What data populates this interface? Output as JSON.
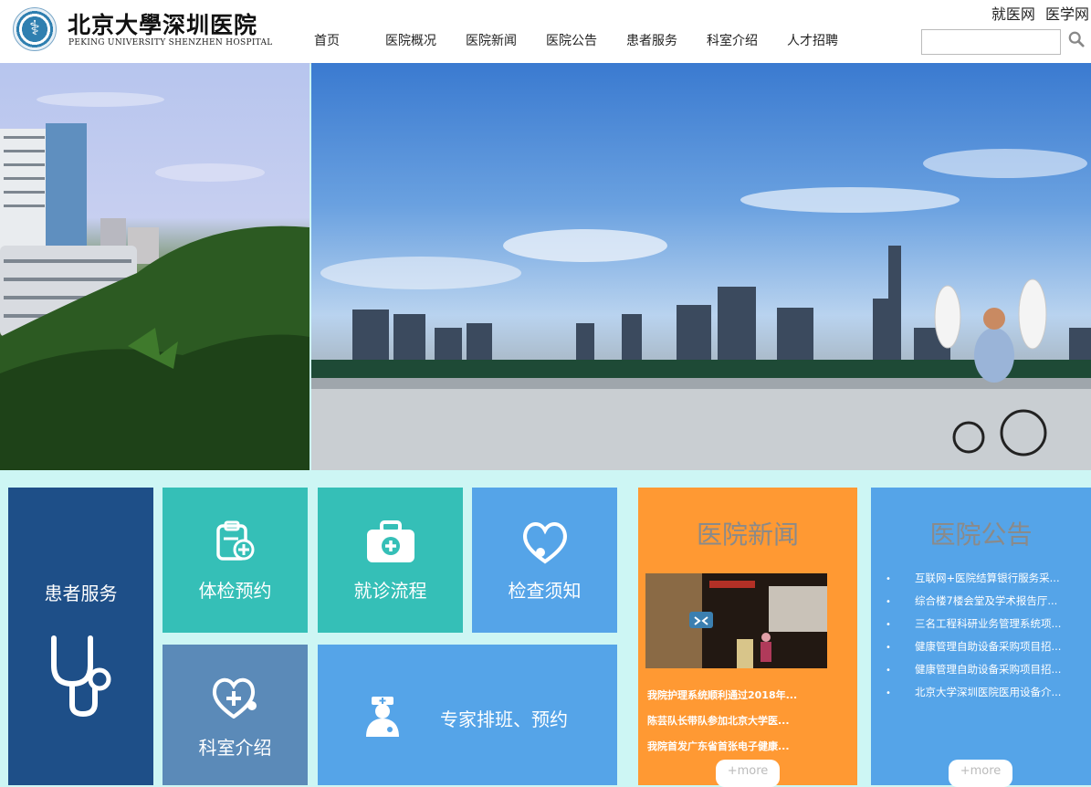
{
  "header": {
    "logo_cn": "北京大學深圳医院",
    "logo_en": "PEKING UNIVERSITY SHENZHEN HOSPITAL",
    "top_links": [
      "就医网",
      "医学网"
    ],
    "search_placeholder": "",
    "nav": [
      "首页",
      "医院概况",
      "医院新闻",
      "医院公告",
      "患者服务",
      "科室介绍",
      "人才招聘"
    ]
  },
  "tiles": {
    "patient_service": "患者服务",
    "checkup": "体检预约",
    "visit_flow": "就诊流程",
    "exam_notice": "检查须知",
    "departments": "科室介绍",
    "experts": "专家排班、预约"
  },
  "news": {
    "title": "医院新闻",
    "items": [
      "我院护理系统顺利通过2018年...",
      "陈芸队长带队参加北京大学医...",
      "我院首发广东省首张电子健康..."
    ],
    "more": "+more"
  },
  "notices": {
    "title": "医院公告",
    "items": [
      "互联网+医院结算银行服务采...",
      "综合楼7楼会堂及学术报告厅...",
      "三名工程科研业务管理系统项...",
      "健康管理自助设备采购项目招...",
      "健康管理自助设备采购项目招...",
      "北京大学深圳医院医用设备介..."
    ],
    "more": "+more"
  },
  "colors": {
    "bg": "#cdf6f4",
    "dark_blue": "#1e4f88",
    "teal": "#35bfb7",
    "blue": "#55a4e8",
    "slate": "#5b8ab8",
    "orange": "#ff9933"
  }
}
